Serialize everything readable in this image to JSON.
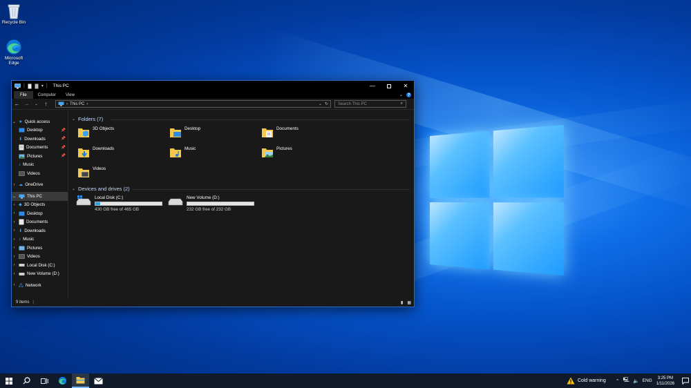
{
  "desktop": {
    "icons": [
      {
        "label": "Recycle Bin",
        "icon": "recycle-bin-icon"
      },
      {
        "label": "Microsoft Edge",
        "icon": "edge-icon"
      }
    ]
  },
  "window": {
    "title": "This PC",
    "ribbon_tabs": [
      "File",
      "Computer",
      "View"
    ],
    "address_path": "This PC",
    "search_placeholder": "Search This PC",
    "nav_pane": {
      "quick_access": "Quick access",
      "quick_items": [
        "Desktop",
        "Downloads",
        "Documents",
        "Pictures",
        "Music",
        "Videos"
      ],
      "onedrive": "OneDrive",
      "this_pc": "This PC",
      "pc_items": [
        "3D Objects",
        "Desktop",
        "Documents",
        "Downloads",
        "Music",
        "Pictures",
        "Videos",
        "Local Disk (C:)",
        "New Volume (D:)"
      ],
      "network": "Network"
    },
    "folders_header": "Folders (7)",
    "folders": [
      "3D Objects",
      "Desktop",
      "Documents",
      "Downloads",
      "Music",
      "Pictures",
      "Videos"
    ],
    "drives_header": "Devices and drives (2)",
    "drives": [
      {
        "name": "Local Disk (C:)",
        "free_text": "430 GB free of 465 GB",
        "used_fraction": 0.075
      },
      {
        "name": "New Volume (D:)",
        "free_text": "232 GB free of 232 GB",
        "used_fraction": 0.0
      }
    ],
    "status": "9 items"
  },
  "taskbar": {
    "weather_text": "Cold warning",
    "language": "ENG",
    "time": "3:25 PM",
    "date": "1/11/2026"
  },
  "colors": {
    "accent": "#26a0da",
    "window_bg": "#191919",
    "taskbar_bg": "#101a2a"
  }
}
